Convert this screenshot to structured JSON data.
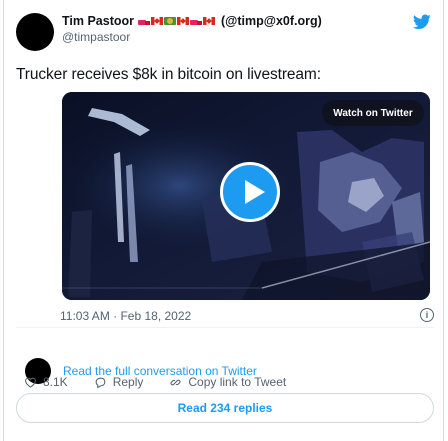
{
  "tweet": {
    "author_name": "Tim Pastoor",
    "author_handle_paren": "(@timp@x0f.org)",
    "author_handle": "@timpastoor",
    "flags": [
      "canada-flag",
      "truck-emoji",
      "canada-flag",
      "map-emoji",
      "canada-flag",
      "truck-emoji",
      "canada-flag"
    ],
    "text": "Trucker receives $8k in bitcoin on livestream:",
    "timestamp": "11:03 AM · Feb 18, 2022"
  },
  "media": {
    "watch_label": "Watch on Twitter",
    "play_icon": "play-icon"
  },
  "conversation_link": "Read the full conversation on Twitter",
  "actions": {
    "like_count": "8.1K",
    "reply_label": "Reply",
    "copy_label": "Copy link to Tweet"
  },
  "read_replies": "Read 234 replies",
  "colors": {
    "accent": "#1d9bf0",
    "muted": "#536471",
    "like_heart": "#536471"
  }
}
